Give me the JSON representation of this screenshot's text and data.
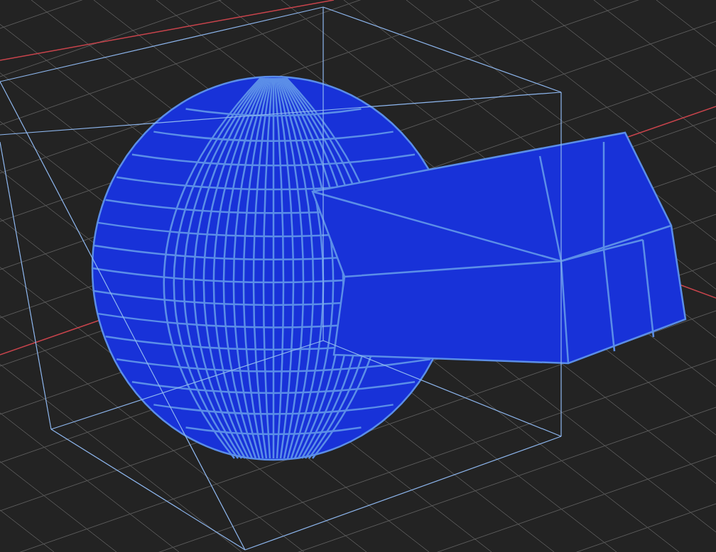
{
  "object": {
    "selected": true
  }
}
